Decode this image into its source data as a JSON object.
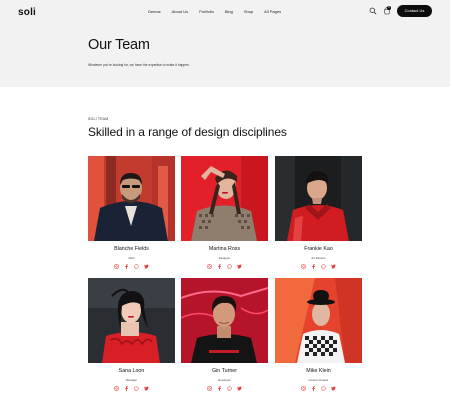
{
  "brand": {
    "logo": "soli"
  },
  "nav": {
    "items": [
      "Demos",
      "About Us",
      "Portfolio",
      "Blog",
      "Shop",
      "All Pages"
    ]
  },
  "header": {
    "cart_count": "0",
    "contact_label": "Contact Us"
  },
  "hero": {
    "title": "Our Team",
    "subtitle": "Whatever you're looking for, we have the expertise to make it happen."
  },
  "team": {
    "eyebrow": "SOLI TEAM",
    "title": "Skilled in a range of design disciplines",
    "members": [
      {
        "name": "Blanche Fields",
        "role": "CEO"
      },
      {
        "name": "Martina Ross",
        "role": "Designer"
      },
      {
        "name": "Frankie Kao",
        "role": "Art Director"
      },
      {
        "name": "Sana Loon",
        "role": "Manager"
      },
      {
        "name": "Gin Turner",
        "role": "Developer"
      },
      {
        "name": "Mike Klein",
        "role": "Content Creator"
      }
    ]
  },
  "icons": [
    "search-icon",
    "cart-icon",
    "instagram-icon",
    "facebook-icon",
    "whatsapp-icon",
    "twitter-icon"
  ],
  "colors": {
    "accent": "#e8393a",
    "dark": "#0c0c0c",
    "band": "#f2f2f2"
  }
}
